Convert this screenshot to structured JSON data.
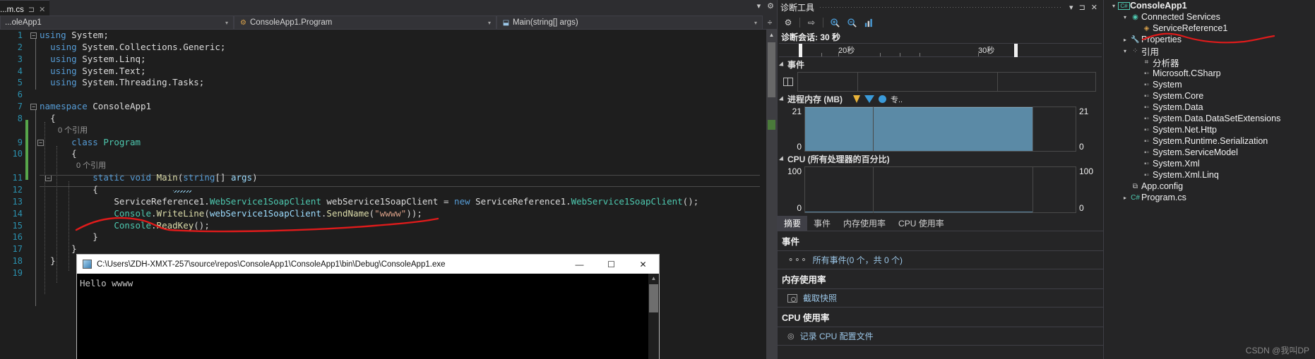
{
  "editor": {
    "tab": {
      "label": "...m.cs",
      "pin_icon": "pin-icon",
      "close_icon": "close-icon"
    },
    "tabstrip_right": {
      "chevron": "▾",
      "gear": "⚙"
    },
    "navbar": {
      "file_scope": "...oleApp1",
      "class_scope": "ConsoleApp1.Program",
      "member_scope": "Main(string[] args)",
      "splitter_icon": "split-window-icon"
    },
    "line_numbers": [
      "1",
      "2",
      "3",
      "4",
      "5",
      "6",
      "7",
      "8",
      "9",
      "10",
      "11",
      "12",
      "13",
      "14",
      "15",
      "16",
      "17",
      "18",
      "19"
    ],
    "codelens": {
      "class_refs": "0 个引用",
      "method_refs": "0 个引用"
    },
    "code": {
      "l1": "using System;",
      "l2": "using System.Collections.Generic;",
      "l3": "using System.Linq;",
      "l4": "using System.Text;",
      "l5": "using System.Threading.Tasks;",
      "l7": "namespace ConsoleApp1",
      "l8": "{",
      "l9": "class Program",
      "l10": "{",
      "l11": "static void Main(string[] args)",
      "l12": "{",
      "l13": "ServiceReference1.WebService1SoapClient webService1SoapClient = new ServiceReference1.WebService1SoapClient();",
      "l14": "Console.WriteLine(webService1SoapClient.SendName(\"wwww\"));",
      "l15": "Console.ReadKey();",
      "l16": "}",
      "l17": "}",
      "l18": "}"
    }
  },
  "console_window": {
    "title": "C:\\Users\\ZDH-XMXT-257\\source\\repos\\ConsoleApp1\\ConsoleApp1\\bin\\Debug\\ConsoleApp1.exe",
    "icon": "console-app-icon",
    "minimize": "—",
    "maximize": "☐",
    "close": "✕",
    "output": "Hello wwww"
  },
  "diagnostics": {
    "title": "诊断工具",
    "header_buttons": {
      "menu": "▾",
      "pin": "pin-icon",
      "close": "✕"
    },
    "toolbar": [
      {
        "name": "settings-icon",
        "glyph": "⚙"
      },
      {
        "name": "export-icon",
        "glyph": "⇥"
      },
      {
        "name": "zoom-in-icon",
        "glyph": "🔍"
      },
      {
        "name": "zoom-out-icon",
        "glyph": "🔍"
      },
      {
        "name": "chart-icon",
        "glyph": "📊"
      }
    ],
    "session_label": "诊断会话: 30 秒",
    "ruler": {
      "ticks": [
        "20秒",
        "30秒"
      ]
    },
    "events_section": "事件",
    "memory_section": "进程内存 (MB)",
    "memory_legend": "专..",
    "cpu_section": "CPU (所有处理器的百分比)",
    "tabs": [
      {
        "label": "摘要",
        "selected": true
      },
      {
        "label": "事件",
        "selected": false
      },
      {
        "label": "内存使用率",
        "selected": false
      },
      {
        "label": "CPU 使用率",
        "selected": false
      }
    ],
    "summary": [
      {
        "head": "事件",
        "item": "所有事件(0 个，共 0 个)",
        "icon": "events-icon"
      },
      {
        "head": "内存使用率",
        "item": "截取快照",
        "icon": "snapshot-icon"
      },
      {
        "head": "CPU 使用率",
        "item": "记录 CPU 配置文件",
        "icon": "cpu-record-icon"
      }
    ]
  },
  "chart_data": [
    {
      "type": "area",
      "title": "进程内存 (MB)",
      "ylabel_left_top": "21",
      "ylabel_left_bottom": "0",
      "ylabel_right_top": "21",
      "ylabel_right_bottom": "0",
      "ylim": [
        0,
        21
      ],
      "x": [
        0,
        10,
        20,
        26,
        30
      ],
      "values": [
        21,
        21,
        21,
        21,
        0
      ],
      "fill_color": "#5b8aa6",
      "grid": true
    },
    {
      "type": "line",
      "title": "CPU (所有处理器的百分比)",
      "ylabel_left_top": "100",
      "ylabel_left_bottom": "0",
      "ylabel_right_top": "100",
      "ylabel_right_bottom": "0",
      "ylim": [
        0,
        100
      ],
      "x": [
        0,
        10,
        20,
        26,
        30
      ],
      "values": [
        0,
        0,
        0,
        0,
        0
      ],
      "line_color": "#5b8aa6",
      "grid": true
    }
  ],
  "solution_explorer": {
    "items": [
      {
        "label": "ConsoleApp1",
        "indent": 0,
        "expander": "▾",
        "icon": "csharp-project-icon",
        "bold": true,
        "icon_color": "#4ec9b0"
      },
      {
        "label": "Connected Services",
        "indent": 1,
        "expander": "▾",
        "icon": "connected-services-icon",
        "bold": false,
        "icon_color": "#4ec9b0"
      },
      {
        "label": "ServiceReference1",
        "indent": 2,
        "expander": "",
        "icon": "service-reference-icon",
        "bold": false,
        "icon_color": "#d8a14a"
      },
      {
        "label": "Properties",
        "indent": 1,
        "expander": "▸",
        "icon": "wrench-icon",
        "bold": false,
        "icon_color": "#c8c8c8"
      },
      {
        "label": "引用",
        "indent": 1,
        "expander": "▾",
        "icon": "references-icon",
        "bold": false,
        "icon_color": "#9a9a9a"
      },
      {
        "label": "分析器",
        "indent": 2,
        "expander": "",
        "icon": "analyzer-icon",
        "bold": false,
        "icon_color": "#c8c8c8"
      },
      {
        "label": "Microsoft.CSharp",
        "indent": 2,
        "expander": "",
        "icon": "assembly-icon",
        "bold": false,
        "icon_color": "#9a9a9a"
      },
      {
        "label": "System",
        "indent": 2,
        "expander": "",
        "icon": "assembly-icon",
        "bold": false,
        "icon_color": "#9a9a9a"
      },
      {
        "label": "System.Core",
        "indent": 2,
        "expander": "",
        "icon": "assembly-icon",
        "bold": false,
        "icon_color": "#9a9a9a"
      },
      {
        "label": "System.Data",
        "indent": 2,
        "expander": "",
        "icon": "assembly-icon",
        "bold": false,
        "icon_color": "#9a9a9a"
      },
      {
        "label": "System.Data.DataSetExtensions",
        "indent": 2,
        "expander": "",
        "icon": "assembly-icon",
        "bold": false,
        "icon_color": "#9a9a9a"
      },
      {
        "label": "System.Net.Http",
        "indent": 2,
        "expander": "",
        "icon": "assembly-icon",
        "bold": false,
        "icon_color": "#9a9a9a"
      },
      {
        "label": "System.Runtime.Serialization",
        "indent": 2,
        "expander": "",
        "icon": "assembly-icon",
        "bold": false,
        "icon_color": "#9a9a9a"
      },
      {
        "label": "System.ServiceModel",
        "indent": 2,
        "expander": "",
        "icon": "assembly-icon",
        "bold": false,
        "icon_color": "#9a9a9a"
      },
      {
        "label": "System.Xml",
        "indent": 2,
        "expander": "",
        "icon": "assembly-icon",
        "bold": false,
        "icon_color": "#9a9a9a"
      },
      {
        "label": "System.Xml.Linq",
        "indent": 2,
        "expander": "",
        "icon": "assembly-icon",
        "bold": false,
        "icon_color": "#9a9a9a"
      },
      {
        "label": "App.config",
        "indent": 1,
        "expander": "",
        "icon": "config-file-icon",
        "bold": false,
        "icon_color": "#c8c8c8"
      },
      {
        "label": "Program.cs",
        "indent": 1,
        "expander": "▸",
        "icon": "csharp-file-icon",
        "bold": false,
        "icon_color": "#4ec9b0"
      }
    ]
  },
  "watermark": "CSDN @我叫DP",
  "colors": {
    "accent_red": "#e01b1b",
    "editor_bg": "#1e1e1e",
    "panel_bg": "#252526",
    "chrome_bg": "#2d2d30"
  }
}
